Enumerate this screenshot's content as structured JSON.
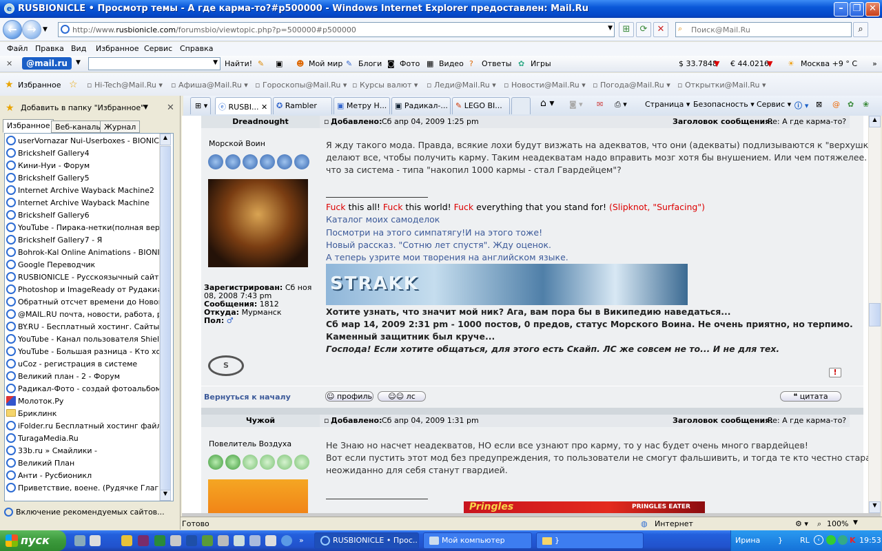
{
  "window": {
    "title": "RUSBIONICLE • Просмотр темы - А где карма-то?#p500000 - Windows Internet Explorer предоставлен: Mail.Ru"
  },
  "address": {
    "url_prefix": "http://www.",
    "url_domain": "rusbionicle.com",
    "url_path": "/forumsbio/viewtopic.php?p=500000#p500000",
    "search_placeholder": "Поиск@Mail.Ru"
  },
  "menu": [
    "Файл",
    "Правка",
    "Вид",
    "Избранное",
    "Сервис",
    "Справка"
  ],
  "mailbar": {
    "logo": "@mail.ru",
    "find": "Найти!",
    "items": [
      "Мой мир",
      "Блоги",
      "Фото",
      "Видео",
      "Ответы",
      "Игры"
    ],
    "usd": "$ 33.7848",
    "eur": "€ 44.0216",
    "weather": "Москва +9 ° С"
  },
  "favbar": {
    "label": "Избранное",
    "items": [
      "Hi-Tech@Mail.Ru",
      "Афиша@Mail.Ru",
      "Гороскопы@Mail.Ru",
      "Курсы валют",
      "Леди@Mail.Ru",
      "Новости@Mail.Ru",
      "Погода@Mail.Ru",
      "Открытки@Mail.Ru"
    ]
  },
  "sidebar": {
    "add_label": "Добавить в папку \"Избранное\"",
    "tabs": [
      "Избранное",
      "Веб-каналы",
      "Журнал"
    ],
    "items": [
      {
        "label": "userVornazar Nui-Userboxes - BIONICL...",
        "icon": "ie"
      },
      {
        "label": "Brickshelf Gallery4",
        "icon": "ie"
      },
      {
        "label": "Кини-Нуи - Форум",
        "icon": "ie"
      },
      {
        "label": "Brickshelf Gallery5",
        "icon": "ie"
      },
      {
        "label": "Internet Archive Wayback Machine2",
        "icon": "ie"
      },
      {
        "label": "Internet Archive Wayback Machine",
        "icon": "ie"
      },
      {
        "label": "Brickshelf Gallery6",
        "icon": "ie"
      },
      {
        "label": "YouTube - Пирака-нетки(полная верс...",
        "icon": "ie"
      },
      {
        "label": "Brickshelf Gallery7 - Я",
        "icon": "ie"
      },
      {
        "label": "Bohrok-Kal Online Animations - BIONIC...",
        "icon": "ie"
      },
      {
        "label": "Google Переводчик",
        "icon": "ie"
      },
      {
        "label": "RUSBIONICLE - Русскоязычный сайт ...",
        "icon": "ie"
      },
      {
        "label": "Photoshop и ImageReady от Рудаки#...",
        "icon": "ie"
      },
      {
        "label": "Обратный отсчет времени до Нового ...",
        "icon": "ie"
      },
      {
        "label": "@MAIL.RU почта, новости, работа, р...",
        "icon": "ie"
      },
      {
        "label": "BY.RU - Бесплатный хостинг. Сайты...",
        "icon": "ie"
      },
      {
        "label": "YouTube - Канал пользователя Shield...",
        "icon": "ie"
      },
      {
        "label": "YouTube - Большая разница - Кто хо...",
        "icon": "ie"
      },
      {
        "label": "uCoz - регистрация в системе",
        "icon": "ie"
      },
      {
        "label": "Великий план - 2 - Форум",
        "icon": "ie"
      },
      {
        "label": "Радикал-Фото - создай фотоальбом ...",
        "icon": "ie"
      },
      {
        "label": "Молоток.Ру",
        "icon": "pen"
      },
      {
        "label": "Бриклинк",
        "icon": "folder"
      },
      {
        "label": "iFolder.ru Бесплатный хостинг файло...",
        "icon": "ie"
      },
      {
        "label": "TuragaMedia.Ru",
        "icon": "ie"
      },
      {
        "label": "33b.ru » Смайлики -",
        "icon": "ie"
      },
      {
        "label": "Великий План",
        "icon": "ie"
      },
      {
        "label": "Анти - Русбионикл",
        "icon": "ie"
      },
      {
        "label": "Приветствие, военe. (Рудячке Глагне)",
        "icon": "ie"
      }
    ],
    "footer": "Включение рекомендуемых сайтов..."
  },
  "tabs": {
    "items": [
      "RUSBI...",
      "Rambler",
      "Метру Н...",
      "Радикал-...",
      "LEGO BI..."
    ],
    "commands": [
      "Страница",
      "Безопасность",
      "Сервис"
    ]
  },
  "posts": [
    {
      "author": "Dreadnought",
      "rank": "Морской Воин",
      "added": "Добавлено:",
      "date": "Сб апр 04, 2009 1:25 pm",
      "subject_label": "Заголовок сообщения:",
      "subject": "Re: А где карма-то?",
      "body": [
        "Я жду такого мода. Правда, всякие лохи будут визжать на адекватов, что они (адекваты) подлизываются к \"верхушке\", и",
        "делают все, чтобы получить карму. Таким неадекватам надо вправить мозг хотя бы внушением. Или чем потяжелее. А",
        "что за система - типа \"накопил 1000 кармы - стал Гвардейцем\"?"
      ],
      "sig_quote": {
        "a": "Fuck",
        "b": " this all! ",
        "c": "Fuck",
        "d": " this world! ",
        "e": "Fuck",
        "f": " everything that you stand for! ",
        "g": "(Slipknot, \"Surfacing\")"
      },
      "sig_links": [
        "Каталог моих самоделок",
        "Посмотри на этого симпатягу!И на этого тоже!",
        "Новый рассказ. \"Сотню лет спустя\". Жду оценок.",
        "А теперь узрите мои творения на английском языке."
      ],
      "banner_text": "STRAKK",
      "sig_tail": [
        "Хотите узнать, что значит мой ник? Ага, вам пора бы в Википедию наведаться...",
        "Сб мар 14, 2009 2:31 pm - 1000 постов, 0 предов, статус Морского Воина. Не очень приятно, но терпимо.",
        "Каменный защитник был круче..."
      ],
      "sig_italic": "Господа! Если хотите общаться, для этого есть Скайп. ЛС же совсем не то... И не для тех.",
      "registered_label": "Зарегистрирован:",
      "registered_a": "Сб ноя",
      "registered_b": "08, 2008 7:43 pm",
      "messages_label": "Сообщения:",
      "messages": "1812",
      "from_label": "Откуда:",
      "from": "Мурманск",
      "gender_label": "Пол:",
      "back_to_top": "Вернуться к началу",
      "btn_profile": "профиль",
      "btn_pm": "лс",
      "btn_quote": "цитата"
    },
    {
      "author": "Чужой",
      "rank": "Повелитель Воздуха",
      "added": "Добавлено:",
      "date": "Сб апр 04, 2009 1:31 pm",
      "subject_label": "Заголовок сообщения:",
      "subject": "Re: А где карма-то?",
      "body": [
        "Не Знаю но насчет неадекватов, НО если все узнают про карму, то у нас будет очень много гвардейцев!",
        "Вот если пустить этот мод без предупреждения, то пользователи не смогут фальшивить, и тогда те кто честно старались,",
        "неожиданно для себя станут гвардией."
      ],
      "banner_text": "Pringles",
      "banner_caption": "PRINGLES EATER"
    }
  ],
  "status": {
    "left": "Готово",
    "zone": "Интернет",
    "zoom": "100%"
  },
  "taskbar": {
    "start": "пуск",
    "tasks": [
      "RUSBIONICLE • Прос...",
      "Мой компьютер",
      "}"
    ],
    "user": "Ирина",
    "brace": "}",
    "lang": "RL",
    "time": "19:53"
  }
}
